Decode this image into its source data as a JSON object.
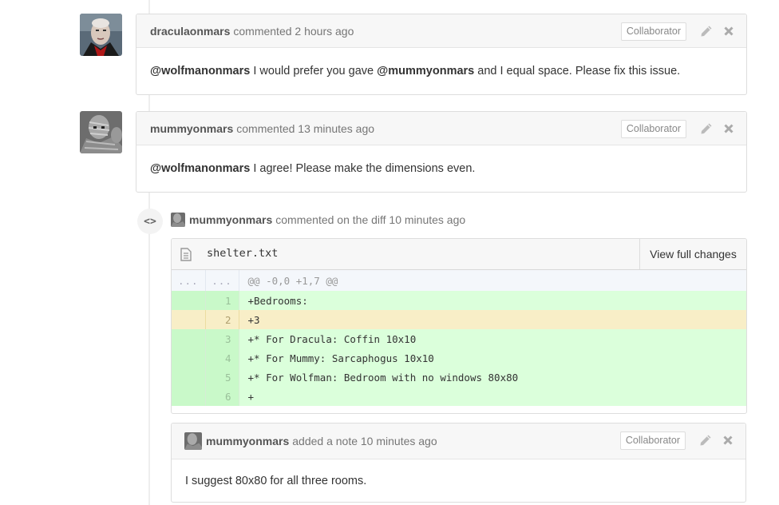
{
  "comments": [
    {
      "author": "draculaonmars",
      "meta": "commented 2 hours ago",
      "badge": "Collaborator",
      "mention1": "@wolfmanonmars",
      "text1": " I would prefer you gave ",
      "mention2": "@mummyonmars",
      "text2": " and I equal space. Please fix this issue."
    },
    {
      "author": "mummyonmars",
      "meta": "commented 13 minutes ago",
      "badge": "Collaborator",
      "mention1": "@wolfmanonmars",
      "text1": " I agree! Please make the dimensions even."
    }
  ],
  "diff_event": {
    "badge_glyph": "<>",
    "author": "mummyonmars",
    "meta": "commented on the diff 10 minutes ago"
  },
  "file": {
    "name": "shelter.txt",
    "view_button": "View full changes",
    "hunk": {
      "old": "...",
      "new": "...",
      "text": "@@ -0,0 +1,7 @@"
    },
    "lines": [
      {
        "num": "1",
        "text": "+Bedrooms:"
      },
      {
        "num": "2",
        "text": "+3"
      },
      {
        "num": "3",
        "text": "+* For Dracula: Coffin 10x10"
      },
      {
        "num": "4",
        "text": "+* For Mummy: Sarcaphogus 10x10"
      },
      {
        "num": "5",
        "text": "+* For Wolfman: Bedroom with no windows 80x80"
      },
      {
        "num": "6",
        "text": "+"
      }
    ]
  },
  "note": {
    "author": "mummyonmars",
    "meta": "added a note 10 minutes ago",
    "badge": "Collaborator",
    "text": "I suggest 80x80 for all three rooms."
  },
  "icons": {
    "edit": "pencil-icon",
    "delete": "close-icon",
    "file": "file-text-icon",
    "diff": "code-icon"
  }
}
